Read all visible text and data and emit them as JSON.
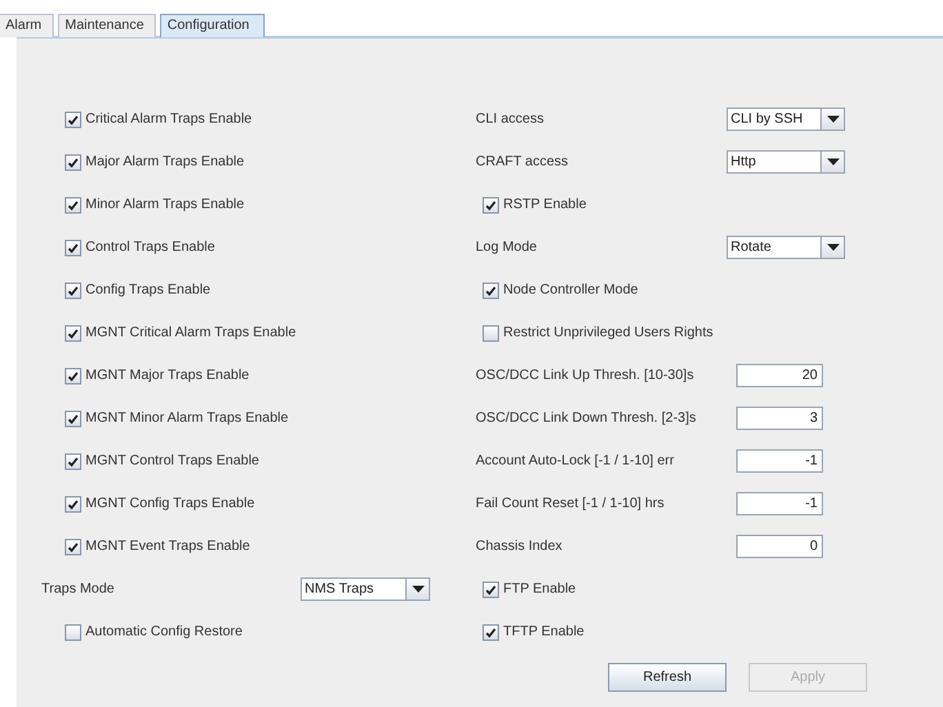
{
  "tabs": [
    {
      "label": "Alarm",
      "selected": false
    },
    {
      "label": "Maintenance",
      "selected": false
    },
    {
      "label": "Configuration",
      "selected": true
    }
  ],
  "left": [
    {
      "kind": "checkbox",
      "label": "Critical Alarm Traps Enable",
      "checked": true
    },
    {
      "kind": "checkbox",
      "label": "Major Alarm Traps Enable",
      "checked": true
    },
    {
      "kind": "checkbox",
      "label": "Minor Alarm Traps Enable",
      "checked": true
    },
    {
      "kind": "checkbox",
      "label": "Control Traps Enable",
      "checked": true
    },
    {
      "kind": "checkbox",
      "label": "Config Traps Enable",
      "checked": true
    },
    {
      "kind": "checkbox",
      "label": "MGNT Critical Alarm Traps Enable",
      "checked": true
    },
    {
      "kind": "checkbox",
      "label": "MGNT Major Traps Enable",
      "checked": true
    },
    {
      "kind": "checkbox",
      "label": "MGNT Minor Alarm Traps Enable",
      "checked": true
    },
    {
      "kind": "checkbox",
      "label": "MGNT Control Traps Enable",
      "checked": true
    },
    {
      "kind": "checkbox",
      "label": "MGNT Config Traps Enable",
      "checked": true
    },
    {
      "kind": "checkbox",
      "label": "MGNT Event Traps Enable",
      "checked": true
    },
    {
      "kind": "combo",
      "label": "Traps Mode",
      "value": "NMS Traps"
    },
    {
      "kind": "checkbox",
      "label": "Automatic Config Restore",
      "checked": false
    }
  ],
  "right": [
    {
      "kind": "combo",
      "label": "CLI access",
      "value": "CLI by SSH"
    },
    {
      "kind": "combo",
      "label": "CRAFT access",
      "value": "Http"
    },
    {
      "kind": "checkbox",
      "label": "RSTP Enable",
      "checked": true
    },
    {
      "kind": "combo",
      "label": "Log Mode",
      "value": "Rotate"
    },
    {
      "kind": "checkbox",
      "label": "Node Controller Mode",
      "checked": true
    },
    {
      "kind": "checkbox",
      "label": "Restrict Unprivileged Users Rights",
      "checked": false
    },
    {
      "kind": "field",
      "label": "OSC/DCC Link Up Thresh. [10-30]s",
      "value": "20"
    },
    {
      "kind": "field",
      "label": "OSC/DCC Link Down Thresh. [2-3]s",
      "value": "3"
    },
    {
      "kind": "field",
      "label": "Account Auto-Lock [-1 / 1-10] err",
      "value": "-1"
    },
    {
      "kind": "field",
      "label": "Fail Count Reset [-1 / 1-10] hrs",
      "value": "-1"
    },
    {
      "kind": "field",
      "label": "Chassis Index",
      "value": "0"
    },
    {
      "kind": "checkbox",
      "label": "FTP Enable",
      "checked": true
    },
    {
      "kind": "checkbox",
      "label": "TFTP Enable",
      "checked": true
    }
  ],
  "buttons": [
    {
      "label": "Refresh",
      "disabled": false
    },
    {
      "label": "Apply",
      "disabled": true
    }
  ]
}
